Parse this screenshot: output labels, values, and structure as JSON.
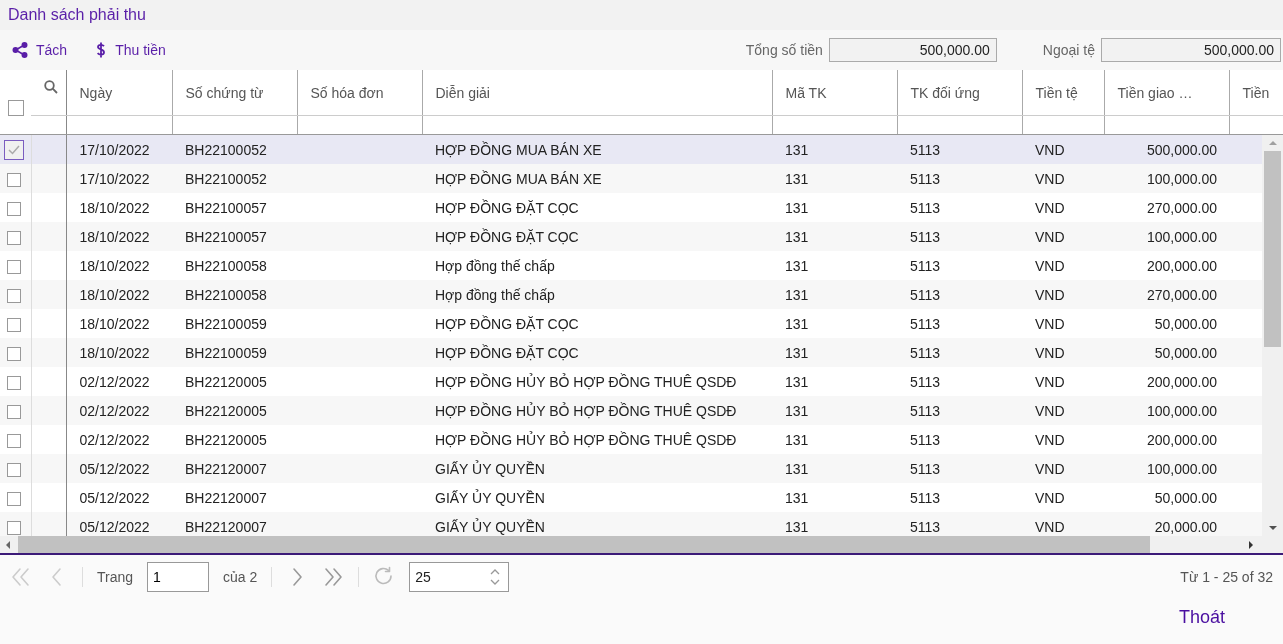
{
  "window": {
    "title": "Danh sách phải thu"
  },
  "toolbar": {
    "actions": [
      {
        "kind": "split",
        "label": "Tách"
      },
      {
        "kind": "money",
        "label": "Thu tiền"
      }
    ],
    "totals": [
      {
        "label": "Tổng số tiền",
        "value": "500,000.00"
      },
      {
        "label": "Ngoại tệ",
        "value": "500,000.00"
      }
    ]
  },
  "table": {
    "select_all_checked": false,
    "columns": [
      {
        "label": "Ngày",
        "kind": "text"
      },
      {
        "label": "Số chứng từ",
        "kind": "text"
      },
      {
        "label": "Số hóa đơn",
        "kind": "text"
      },
      {
        "label": "Diễn giải",
        "kind": "text"
      },
      {
        "label": "Mã TK",
        "kind": "text"
      },
      {
        "label": "TK đối ứng",
        "kind": "text"
      },
      {
        "label": "Tiền tệ",
        "kind": "text"
      },
      {
        "label": "Tiền giao …",
        "kind": "amount"
      },
      {
        "label": "Tiền",
        "kind": "text"
      }
    ],
    "rows": [
      {
        "selected": true,
        "checked": true,
        "cells": [
          "17/10/2022",
          "BH22100052",
          "",
          "HỢP ĐỒNG MUA BÁN XE",
          "131",
          "5113",
          "VND",
          "500,000.00",
          ""
        ]
      },
      {
        "selected": false,
        "checked": false,
        "cells": [
          "17/10/2022",
          "BH22100052",
          "",
          "HỢP ĐỒNG MUA BÁN XE",
          "131",
          "5113",
          "VND",
          "100,000.00",
          ""
        ]
      },
      {
        "selected": false,
        "checked": false,
        "cells": [
          "18/10/2022",
          "BH22100057",
          "",
          "HỢP ĐỒNG ĐẶT CỌC",
          "131",
          "5113",
          "VND",
          "270,000.00",
          ""
        ]
      },
      {
        "selected": false,
        "checked": false,
        "cells": [
          "18/10/2022",
          "BH22100057",
          "",
          "HỢP ĐỒNG ĐẶT CỌC",
          "131",
          "5113",
          "VND",
          "100,000.00",
          ""
        ]
      },
      {
        "selected": false,
        "checked": false,
        "cells": [
          "18/10/2022",
          "BH22100058",
          "",
          "Hợp đồng thế chấp",
          "131",
          "5113",
          "VND",
          "200,000.00",
          ""
        ]
      },
      {
        "selected": false,
        "checked": false,
        "cells": [
          "18/10/2022",
          "BH22100058",
          "",
          "Hợp đồng thế chấp",
          "131",
          "5113",
          "VND",
          "270,000.00",
          ""
        ]
      },
      {
        "selected": false,
        "checked": false,
        "cells": [
          "18/10/2022",
          "BH22100059",
          "",
          "HỢP ĐỒNG ĐẶT CỌC",
          "131",
          "5113",
          "VND",
          "50,000.00",
          ""
        ]
      },
      {
        "selected": false,
        "checked": false,
        "cells": [
          "18/10/2022",
          "BH22100059",
          "",
          "HỢP ĐỒNG ĐẶT CỌC",
          "131",
          "5113",
          "VND",
          "50,000.00",
          ""
        ]
      },
      {
        "selected": false,
        "checked": false,
        "cells": [
          "02/12/2022",
          "BH22120005",
          "",
          "HỢP ĐỒNG HỦY BỎ HỢP ĐỒNG THUÊ QSDĐ",
          "131",
          "5113",
          "VND",
          "200,000.00",
          ""
        ]
      },
      {
        "selected": false,
        "checked": false,
        "cells": [
          "02/12/2022",
          "BH22120005",
          "",
          "HỢP ĐỒNG HỦY BỎ HỢP ĐỒNG THUÊ QSDĐ",
          "131",
          "5113",
          "VND",
          "100,000.00",
          ""
        ]
      },
      {
        "selected": false,
        "checked": false,
        "cells": [
          "02/12/2022",
          "BH22120005",
          "",
          "HỢP ĐỒNG HỦY BỎ HỢP ĐỒNG THUÊ QSDĐ",
          "131",
          "5113",
          "VND",
          "200,000.00",
          ""
        ]
      },
      {
        "selected": false,
        "checked": false,
        "cells": [
          "05/12/2022",
          "BH22120007",
          "",
          "GIẤY ỦY QUYỀN",
          "131",
          "5113",
          "VND",
          "100,000.00",
          ""
        ]
      },
      {
        "selected": false,
        "checked": false,
        "cells": [
          "05/12/2022",
          "BH22120007",
          "",
          "GIẤY ỦY QUYỀN",
          "131",
          "5113",
          "VND",
          "50,000.00",
          ""
        ]
      },
      {
        "selected": false,
        "checked": false,
        "cells": [
          "05/12/2022",
          "BH22120007",
          "",
          "GIẤY ỦY QUYỀN",
          "131",
          "5113",
          "VND",
          "20,000.00",
          ""
        ]
      }
    ]
  },
  "pager": {
    "page_label": "Trang",
    "page": "1",
    "of_label": "của 2",
    "page_size": "25",
    "summary": "Từ 1 - 25 of 32"
  },
  "footer": {
    "close_label": "Thoát"
  }
}
